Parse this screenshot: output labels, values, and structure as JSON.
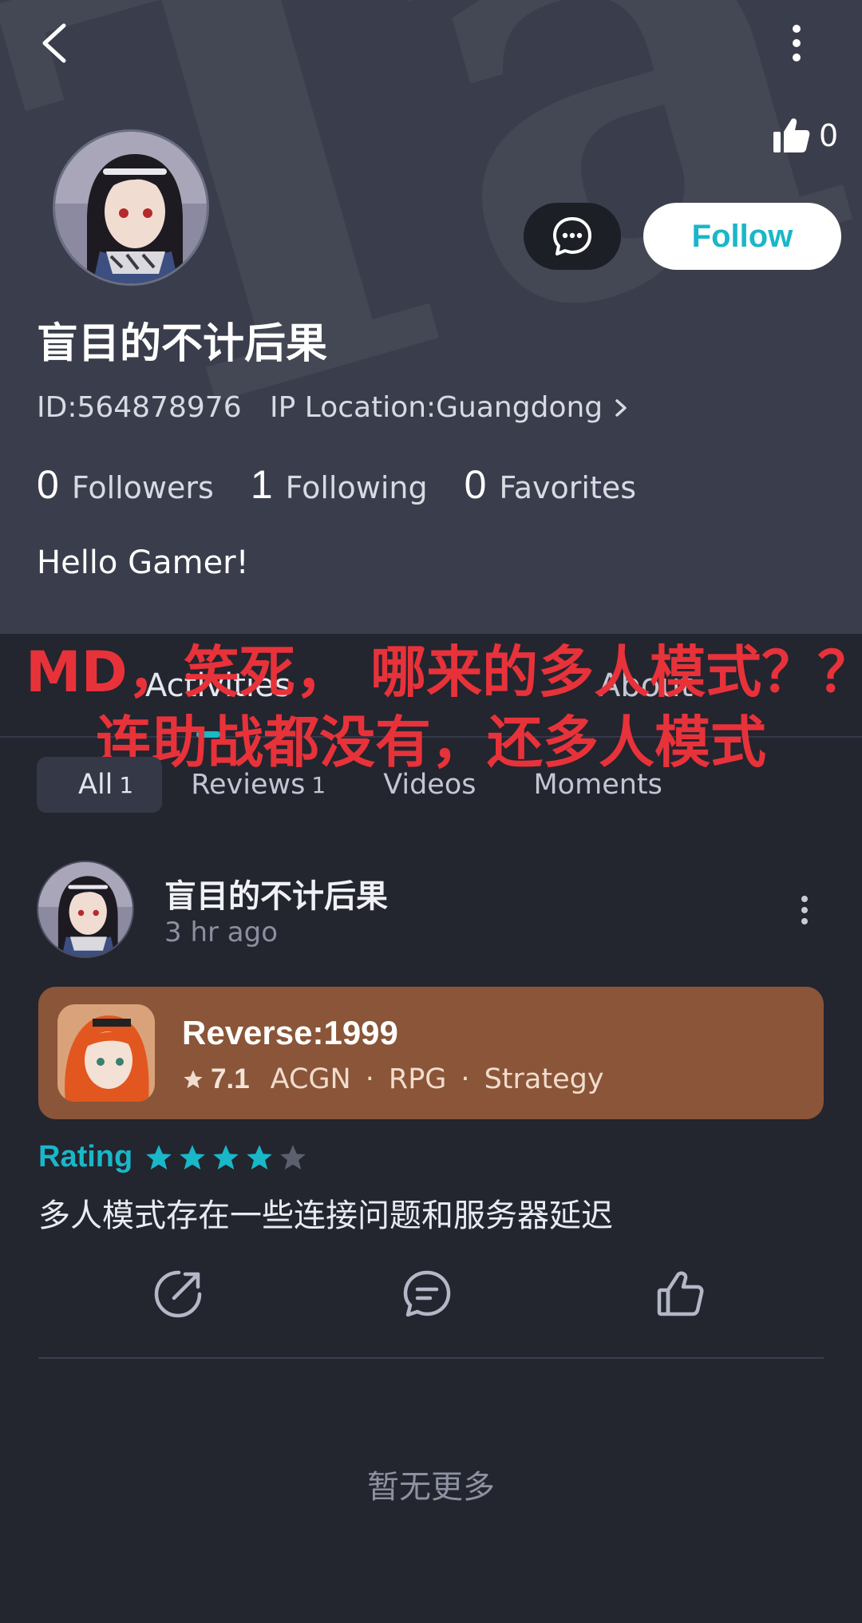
{
  "header": {
    "likes_count": "0",
    "username": "盲目的不计后果",
    "user_id": "ID:564878976",
    "ip_location": "IP Location:Guangdong",
    "follow_label": "Follow",
    "bio": "Hello Gamer!",
    "stats": [
      {
        "count": "0",
        "label": "Followers"
      },
      {
        "count": "1",
        "label": "Following"
      },
      {
        "count": "0",
        "label": "Favorites"
      }
    ],
    "accent_color": "#19b7c8"
  },
  "main_tabs": {
    "activities": "Activities",
    "about": "About"
  },
  "overlay_text": {
    "line1": "MD，笑死， 哪来的多人模式？？",
    "line2": "连助战都没有，还多人模式",
    "color": "#e8323a"
  },
  "sub_tabs": [
    {
      "label": "All",
      "count": "1"
    },
    {
      "label": "Reviews",
      "count": "1"
    },
    {
      "label": "Videos",
      "count": ""
    },
    {
      "label": "Moments",
      "count": ""
    }
  ],
  "post": {
    "author": "盲目的不计后果",
    "time": "3 hr ago",
    "game": {
      "name": "Reverse:1999",
      "score": "7.1",
      "tags": [
        "ACGN",
        "RPG",
        "Strategy"
      ],
      "card_color": "#8a5538"
    },
    "rating_label": "Rating",
    "rating_value": 4,
    "rating_max": 5,
    "text": "多人模式存在一些连接问题和服务器延迟",
    "actions": [
      "share-icon",
      "comment-icon",
      "like-icon"
    ]
  },
  "footer": {
    "no_more": "暂无更多"
  }
}
